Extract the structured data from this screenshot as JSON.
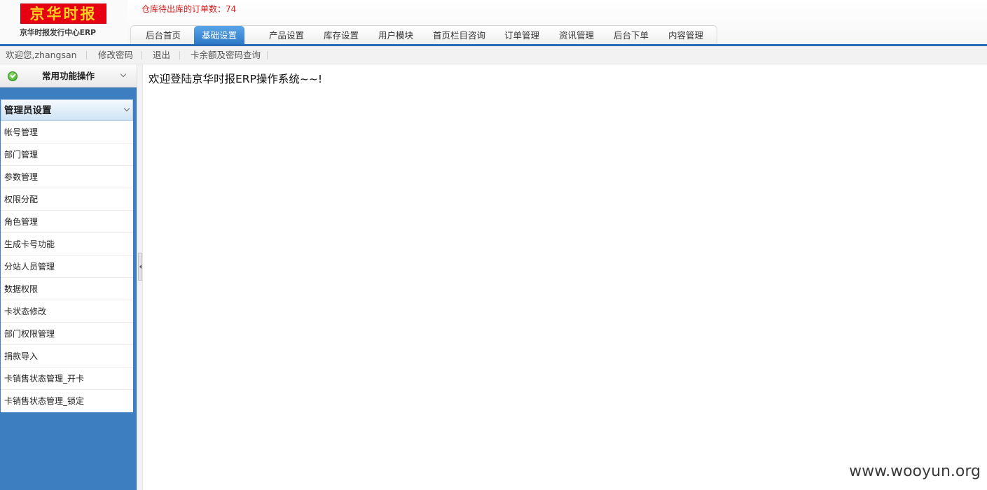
{
  "logo": {
    "brand": "京华时报",
    "subtitle": "京华时报发行中心ERP"
  },
  "header": {
    "order_notice": "仓库待出库的订单数：74"
  },
  "tabs": [
    {
      "label": "后台首页",
      "active": false
    },
    {
      "label": "基础设置",
      "active": true
    },
    {
      "label": "产品设置",
      "active": false
    },
    {
      "label": "库存设置",
      "active": false
    },
    {
      "label": "用户模块",
      "active": false
    },
    {
      "label": "首页栏目咨询",
      "active": false
    },
    {
      "label": "订单管理",
      "active": false
    },
    {
      "label": "资讯管理",
      "active": false
    },
    {
      "label": "后台下单",
      "active": false
    },
    {
      "label": "内容管理",
      "active": false
    }
  ],
  "userbar": {
    "welcome": "欢迎您,zhangsan",
    "change_password": "修改密码",
    "logout": "退出",
    "card_query": "卡余额及密码查询"
  },
  "sidebar": {
    "top_label": "常用功能操作",
    "section_title": "管理员设置",
    "items": [
      {
        "label": "帐号管理"
      },
      {
        "label": "部门管理"
      },
      {
        "label": "参数管理"
      },
      {
        "label": "权限分配"
      },
      {
        "label": "角色管理"
      },
      {
        "label": "生成卡号功能"
      },
      {
        "label": "分站人员管理"
      },
      {
        "label": "数据权限"
      },
      {
        "label": "卡状态修改"
      },
      {
        "label": "部门权限管理"
      },
      {
        "label": "捐款导入"
      },
      {
        "label": "卡销售状态管理_开卡"
      },
      {
        "label": "卡销售状态管理_锁定"
      }
    ]
  },
  "main": {
    "welcome_text": "欢迎登陆京华时报ERP操作系统~~!"
  },
  "watermark": "www.wooyun.org",
  "colors": {
    "accent_blue": "#2a6cb7",
    "sidebar_blue": "#3d7ec0",
    "notice_red": "#d61a1a",
    "logo_red": "#e60012"
  }
}
